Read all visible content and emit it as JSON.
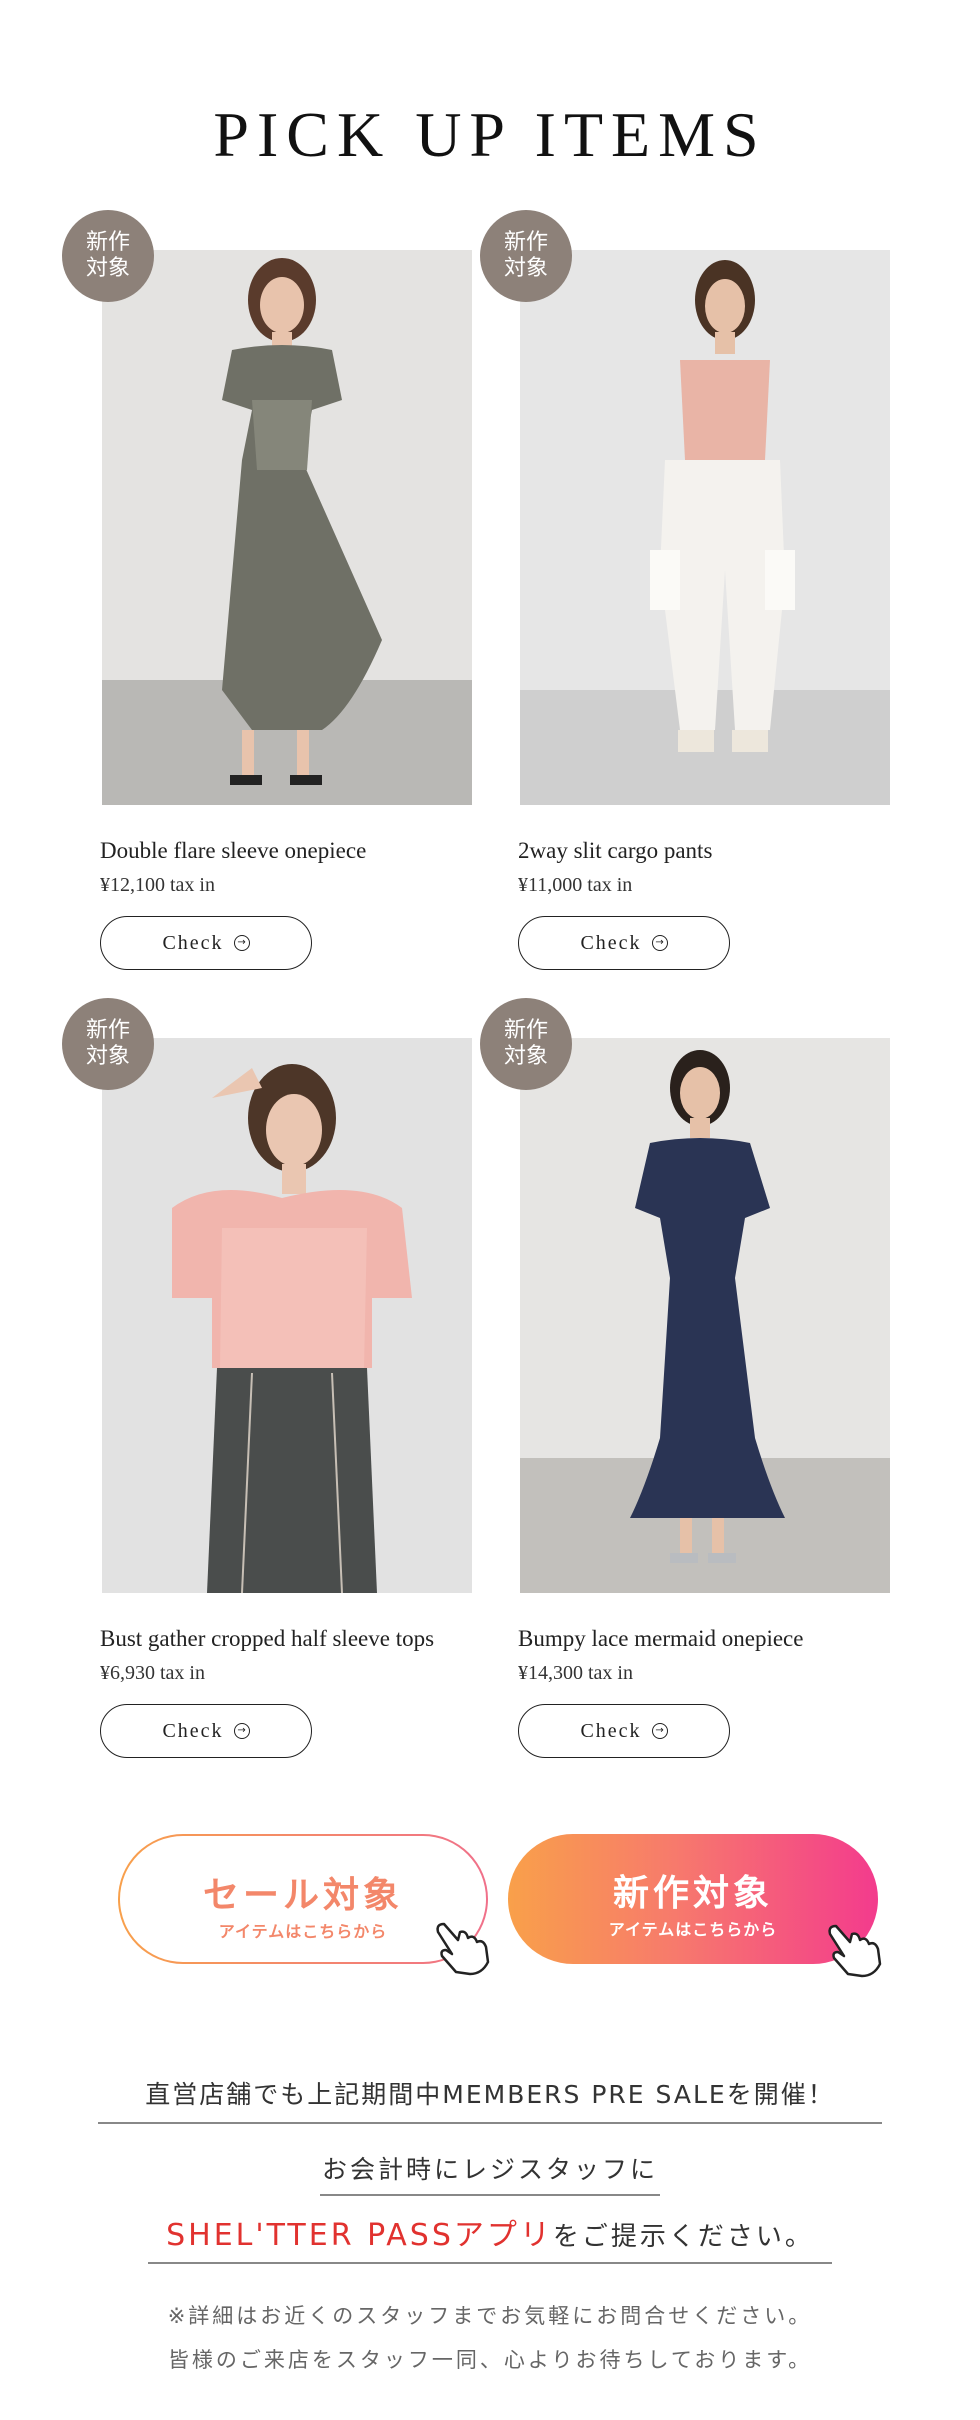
{
  "page": {
    "title": "PICK UP ITEMS"
  },
  "badge": {
    "line1": "新作",
    "line2": "対象"
  },
  "items": [
    {
      "name": "Double flare sleeve onepiece",
      "price": "¥12,100 tax in",
      "button": "Check"
    },
    {
      "name": "2way slit cargo pants",
      "price": "¥11,000 tax in",
      "button": "Check"
    },
    {
      "name": "Bust gather cropped half sleeve tops",
      "price": "¥6,930 tax in",
      "button": "Check"
    },
    {
      "name": "Bumpy lace mermaid onepiece",
      "price": "¥14,300 tax in",
      "button": "Check"
    }
  ],
  "cta": {
    "sale": {
      "title": "セール対象",
      "sub": "アイテムはこちらから"
    },
    "new": {
      "title": "新作対象",
      "sub": "アイテムはこちらから"
    }
  },
  "info": {
    "line1": "直営店舗でも上記期間中MEMBERS PRE SALEを開催！",
    "line2": "お会計時にレジスタッフに",
    "line3_accent": "SHEL'TTER PASSアプリ",
    "line3_rest": "をご提示ください。",
    "note1": "※詳細はお近くのスタッフまでお気軽にお問合せください。",
    "note2": "皆様のご来店をスタッフ一同、心よりお待ちしております。"
  },
  "colors": {
    "badge": "#8d8179",
    "sale_gradient": [
      "#f8a04b",
      "#f0708a"
    ],
    "new_gradient": [
      "#f9a04a",
      "#f33b8d"
    ],
    "accent_red": "#e1322f"
  }
}
